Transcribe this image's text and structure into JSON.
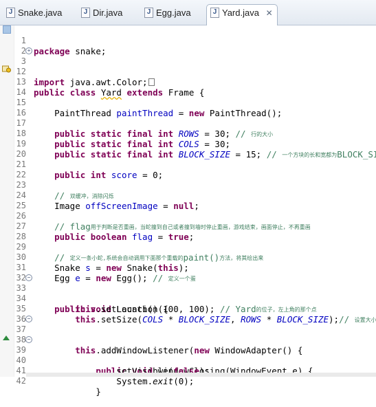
{
  "tabs": [
    {
      "label": "Snake.java",
      "active": false
    },
    {
      "label": "Dir.java",
      "active": false
    },
    {
      "label": "Egg.java",
      "active": false
    },
    {
      "label": "Yard.java",
      "active": true
    }
  ],
  "tab_close_glyph": "✕",
  "file_icon_glyph": "J",
  "line_numbers": [
    "1",
    "2",
    "3",
    "12",
    "13",
    "14",
    "15",
    "16",
    "17",
    "18",
    "19",
    "20",
    "21",
    "22",
    "23",
    "24",
    "25",
    "26",
    "27",
    "28",
    "29",
    "30",
    "31",
    "32",
    "33",
    "34",
    "35",
    "36",
    "37",
    "38",
    "39",
    "40",
    "41",
    "42"
  ],
  "code": {
    "l1_package": "package",
    "l1_rest": " snake;",
    "l3_import": "import",
    "l3_rest": " java.awt.Color;",
    "l13_public": "public",
    "l13_class": "class",
    "l13_name": "Yard",
    "l13_extends": "extends",
    "l13_rest": " Frame {",
    "l15_a": "    PaintThread ",
    "l15_field": "paintThread",
    "l15_b": " = ",
    "l15_new": "new",
    "l15_c": " PaintThread();",
    "l17_kw": "public static final int",
    "l17_field": "ROWS",
    "l17_val": " = 30; ",
    "l17_cm": "// ",
    "l17_cm2": "行的大小",
    "l18_kw": "public static final int",
    "l18_field": "COLS",
    "l18_val": " = 30;",
    "l19_kw": "public static final int",
    "l19_field": "BLOCK_SIZE",
    "l19_val": " = 15; ",
    "l19_cm": "// ",
    "l19_cm2": "一个方块的长和宽都为",
    "l19_cm3": "BLOCK_SIZE",
    "l21_kw": "public int",
    "l21_field": "score",
    "l21_val": " = 0;",
    "l23_cm": "// ",
    "l23_cm2": "双缓冲，消除闪烁",
    "l24_a": "    Image ",
    "l24_field": "offScreenImage",
    "l24_b": " = ",
    "l24_null": "null",
    "l24_c": ";",
    "l26_cm": "// flag",
    "l26_cm2": "用于判断是否重画，当蛇撞到自己或者撞到墙时停止重画，游戏结束，画面停止，不再重画",
    "l27_kw": "public boolean",
    "l27_field": "flag",
    "l27_b": " = ",
    "l27_true": "true",
    "l27_c": ";",
    "l29_cm": "// ",
    "l29_cm2": "定义一条小蛇,系统会自动调用下面那个重载的",
    "l29_cm3": "paint()",
    "l29_cm4": "方法，将其绘出来",
    "l30_a": "    Snake ",
    "l30_field": "s",
    "l30_b": " = ",
    "l30_new": "new",
    "l30_c": " Snake(",
    "l30_this": "this",
    "l30_d": ");",
    "l31_a": "    Egg ",
    "l31_field": "e",
    "l31_b": " = ",
    "l31_new": "new",
    "l31_c": " Egg(); ",
    "l31_cm": "// ",
    "l31_cm2": "定义一个蛋",
    "l33_kw": "public void",
    "l33_rest": " Launch() {",
    "l34_this": "this",
    "l34_a": ".setLocation(100, 100); ",
    "l34_cm": "// Yard",
    "l34_cm2": "的位子，左上角的那个点",
    "l35_this": "this",
    "l35_a": ".setSize(",
    "l35_f1": "COLS",
    "l35_b": " * ",
    "l35_f2": "BLOCK_SIZE",
    "l35_c": ", ",
    "l35_f3": "ROWS",
    "l35_d": " * ",
    "l35_f4": "BLOCK_SIZE",
    "l35_e": ");",
    "l35_cm": "// ",
    "l35_cm2": "设置大小",
    "l37_this": "this",
    "l37_a": ".addWindowListener(",
    "l37_new": "new",
    "l37_b": " WindowAdapter() {",
    "l39_kw": "public void",
    "l39_rest": " windowClosing(WindowEvent e) {",
    "l40_a": "setVisible(",
    "l40_false": "false",
    "l40_b": ");",
    "l41_a": "System.",
    "l41_out": "exit",
    "l41_b": "(0);",
    "l42_a": "}"
  }
}
